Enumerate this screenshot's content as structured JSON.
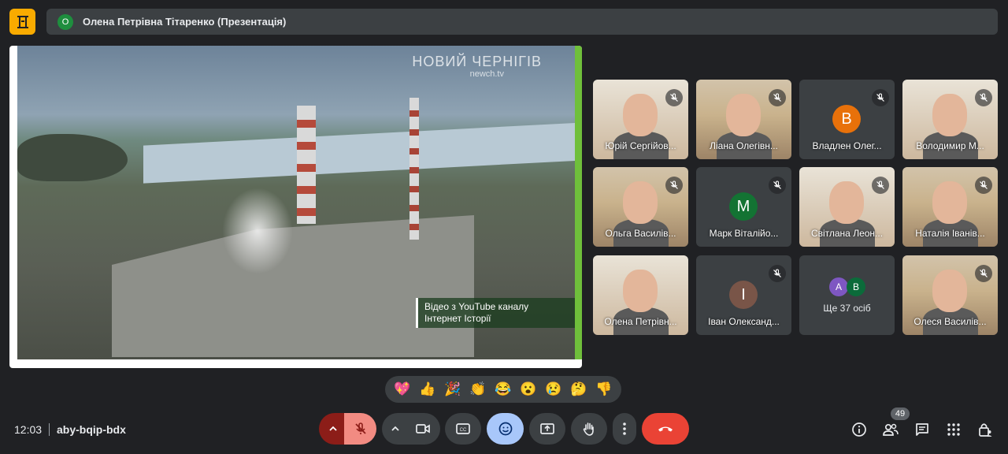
{
  "header": {
    "badge_letter": "О",
    "title": "Олена Петрівна Тітаренко (Презентація)"
  },
  "presentation": {
    "logo_text": "НОВИЙ ЧЕРНІГІВ",
    "logo_sub": "newch.tv",
    "caption_line1": "Відео з YouTube каналу",
    "caption_line2": "Інтернет Історії"
  },
  "participants": [
    {
      "name": "Юрій Сергійов...",
      "type": "video",
      "muted": true
    },
    {
      "name": "Ліана Олегівн...",
      "type": "video",
      "muted": true
    },
    {
      "name": "Владлен Олег...",
      "type": "avatar",
      "letter": "В",
      "color": "#e8710a",
      "muted": true
    },
    {
      "name": "Володимир М...",
      "type": "video",
      "muted": true
    },
    {
      "name": "Ольга Василів...",
      "type": "video",
      "muted": true
    },
    {
      "name": "Марк Віталійо...",
      "type": "avatar",
      "letter": "M",
      "color": "#137333",
      "muted": true
    },
    {
      "name": "Світлана Леон...",
      "type": "video",
      "muted": true
    },
    {
      "name": "Наталія Іванів...",
      "type": "video",
      "muted": true
    },
    {
      "name": "Олена Петрівн...",
      "type": "video",
      "muted": false
    },
    {
      "name": "Іван Олександ...",
      "type": "avatar",
      "letter": "І",
      "color": "#795548",
      "muted": true
    },
    {
      "name": "Ще 37 осіб",
      "type": "more",
      "letters": [
        "А",
        "В"
      ],
      "colors": [
        "#7e57c2",
        "#0b6b3a"
      ],
      "muted": false
    },
    {
      "name": "Олеся Василів...",
      "type": "video",
      "muted": true
    }
  ],
  "reactions": [
    "💖",
    "👍",
    "🎉",
    "👏",
    "😂",
    "😮",
    "😢",
    "🤔",
    "👎"
  ],
  "footer": {
    "time": "12:03",
    "meeting_code": "aby-bqip-bdx",
    "people_count": "49"
  },
  "colors": {
    "background": "#202124",
    "surface": "#3c4043",
    "mic_off_red": "#8c1d18",
    "end_call_red": "#ea4335",
    "reactions_active": "#a8c7fa"
  }
}
